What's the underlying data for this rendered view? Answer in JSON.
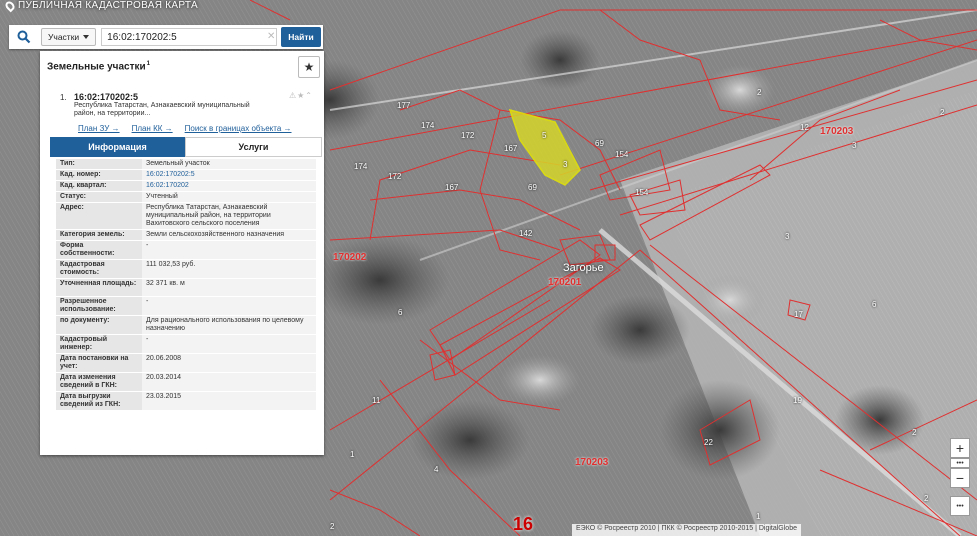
{
  "app_title": "ПУБЛИЧНАЯ КАДАСТРОВАЯ КАРТА",
  "search": {
    "type_label": "Участки",
    "query": "16:02:170202:5",
    "find_label": "Найти"
  },
  "panel": {
    "title": "Земельные участки",
    "count": "1",
    "card": {
      "index": "1.",
      "cad_number": "16:02:170202:5",
      "address": "Республика Татарстан, Азнакаевский муниципальный район, на территории..."
    },
    "links": [
      "План ЗУ →",
      "План КК →",
      "Поиск в границах объекта →"
    ],
    "tabs": [
      "Информация",
      "Услуги"
    ],
    "properties": [
      {
        "key": "Тип:",
        "value": "Земельный участок"
      },
      {
        "key": "Кад. номер:",
        "value": "16:02:170202:5"
      },
      {
        "key": "Кад. квартал:",
        "value": "16:02:170202"
      },
      {
        "key": "Статус:",
        "value": "Учтенный"
      },
      {
        "key": "Адрес:",
        "value": "Республика Татарстан, Азнакаевский муниципальный район, на территории Вахитовского сельского поселения"
      },
      {
        "key": "Категория земель:",
        "value": "Земли сельскохозяйственного назначения"
      },
      {
        "key": "Форма собственности:",
        "value": "-"
      },
      {
        "key": "Кадастровая стоимость:",
        "value": "111 032,53 руб."
      },
      {
        "key": "Уточненная площадь:",
        "value": "32 371 кв. м"
      },
      {
        "key": "Разрешенное использование:",
        "value": "-"
      },
      {
        "key": "по документу:",
        "value": "Для рационального использования по целевому назначению"
      },
      {
        "key": "Кадастровый инженер:",
        "value": "-"
      },
      {
        "key": "Дата постановки на учет:",
        "value": "20.06.2008"
      },
      {
        "key": "Дата изменения сведений в ГКН:",
        "value": "20.03.2014"
      },
      {
        "key": "Дата выгрузки сведений из ГКН:",
        "value": "23.03.2015"
      }
    ]
  },
  "map": {
    "parcel_numbers": [
      "2",
      "12",
      "177",
      "174",
      "172",
      "167",
      "5",
      "3",
      "69",
      "154",
      "154",
      "174",
      "172",
      "167",
      "69",
      "142",
      "3",
      "2",
      "3",
      "6",
      "6",
      "11",
      "1",
      "4",
      "19",
      "17",
      "22",
      "2",
      "2",
      "1",
      "2"
    ],
    "quarter_labels": [
      "170203",
      "170202",
      "170201",
      "170203"
    ],
    "place_label": "Загорье",
    "big_number": "16",
    "attribution": "ЕЭКО © Росреестр 2010 | ПКК © Росреестр 2010-2015 | DigitalGlobe"
  },
  "controls": {
    "zoom_in": "+",
    "zoom_out": "−",
    "dots": "•••"
  },
  "colors": {
    "accent": "#1f5f9a",
    "parcel_line": "#e03030",
    "selected_fill": "#d6d62a"
  }
}
